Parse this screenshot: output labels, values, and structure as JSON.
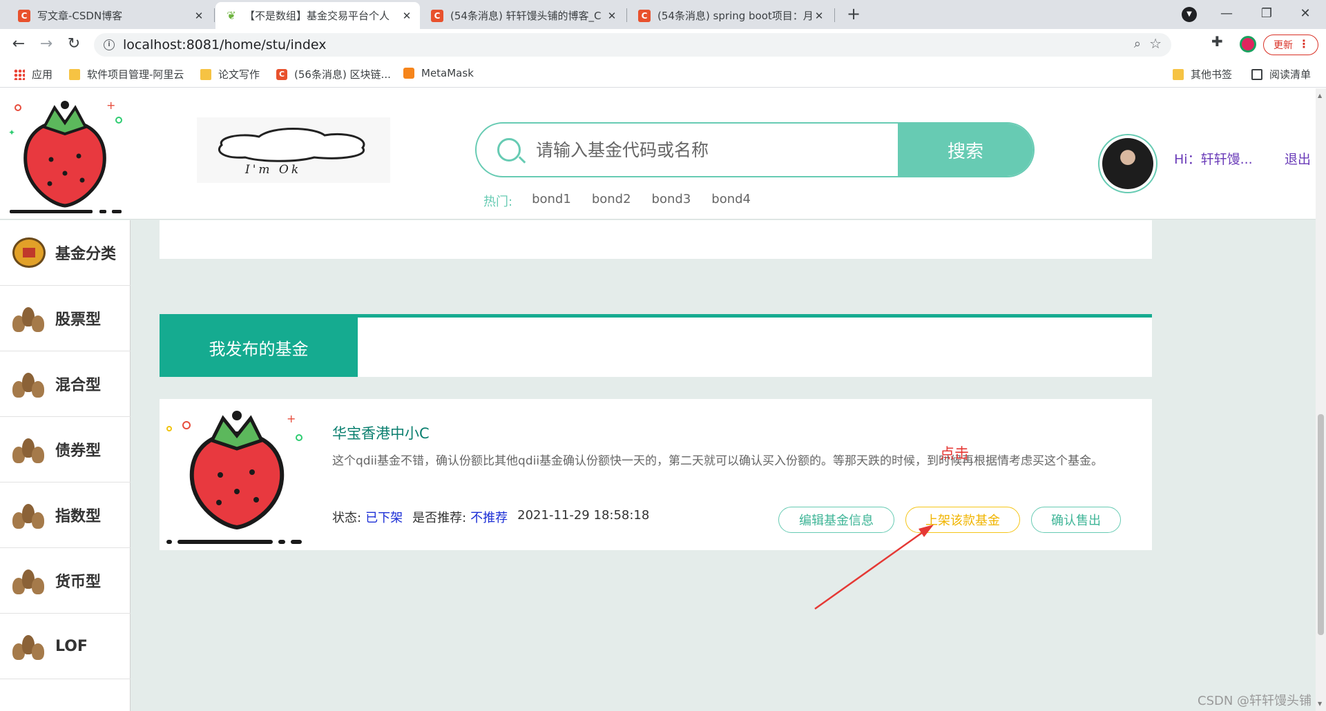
{
  "browser": {
    "tabs": [
      {
        "title": "写文章-CSDN博客",
        "favicon": "csdn-icon",
        "active": false
      },
      {
        "title": "【不是数组】基金交易平台个人",
        "favicon": "spring-leaf-icon",
        "active": true
      },
      {
        "title": "(54条消息) 轩轩馒头铺的博客_C",
        "favicon": "csdn-icon",
        "active": false
      },
      {
        "title": "(54条消息) spring boot项目：月",
        "favicon": "csdn-icon",
        "active": false
      }
    ],
    "url": "localhost:8081/home/stu/index",
    "update_label": "更新",
    "bookmarks": [
      {
        "label": "应用",
        "icon": "apps-grid-icon"
      },
      {
        "label": "软件项目管理-阿里云",
        "icon": "folder-icon"
      },
      {
        "label": "论文写作",
        "icon": "folder-icon"
      },
      {
        "label": "(56条消息) 区块链...",
        "icon": "csdn-icon"
      },
      {
        "label": "MetaMask",
        "icon": "metamask-fox-icon"
      }
    ],
    "bookmarks_right": [
      {
        "label": "其他书签",
        "icon": "folder-icon"
      },
      {
        "label": "阅读清单",
        "icon": "reading-list-icon"
      }
    ],
    "csdn_letter": "C"
  },
  "header": {
    "sketch_text": "I'm   Ok",
    "search_placeholder": "请输入基金代码或名称",
    "search_button": "搜索",
    "hot_label": "热门:",
    "hot_items": [
      "bond1",
      "bond2",
      "bond3",
      "bond4"
    ],
    "greeting": "Hi：轩轩馒...",
    "logout": "退出"
  },
  "sidebar": {
    "items": [
      {
        "label": "基金分类",
        "icon": "bond-badge-icon"
      },
      {
        "label": "股票型",
        "icon": "money-bags-icon"
      },
      {
        "label": "混合型",
        "icon": "money-bags-icon"
      },
      {
        "label": "债券型",
        "icon": "money-bags-icon"
      },
      {
        "label": "指数型",
        "icon": "money-bags-icon"
      },
      {
        "label": "货币型",
        "icon": "money-bags-icon"
      },
      {
        "label": "LOF",
        "icon": "money-bags-icon"
      }
    ]
  },
  "main": {
    "section_title": "我发布的基金",
    "fund": {
      "name": "华宝香港中小C",
      "description": "这个qdii基金不错，确认份额比其他qdii基金确认份额快一天的，第二天就可以确认买入份额的。等那天跌的时候，到时候再根据情考虑买这个基金。",
      "status_label": "状态:",
      "status_value": "已下架",
      "recommend_label": "是否推荐:",
      "recommend_value": "不推荐",
      "datetime": "2021-11-29 18:58:18",
      "buttons": {
        "edit": "编辑基金信息",
        "list": "上架该款基金",
        "sell": "确认售出"
      }
    }
  },
  "annotation": {
    "text": "点击",
    "color": "#e53935"
  },
  "watermark": "CSDN @轩轩馒头铺",
  "colors": {
    "accent": "#67cbb3",
    "section": "#15ab90",
    "fund_name": "#0a7f6f",
    "user_text": "#6a3bb8",
    "status_blue": "#1c2fd6",
    "button_yellow": "#f5c518",
    "page_bg": "#e4ecea"
  }
}
